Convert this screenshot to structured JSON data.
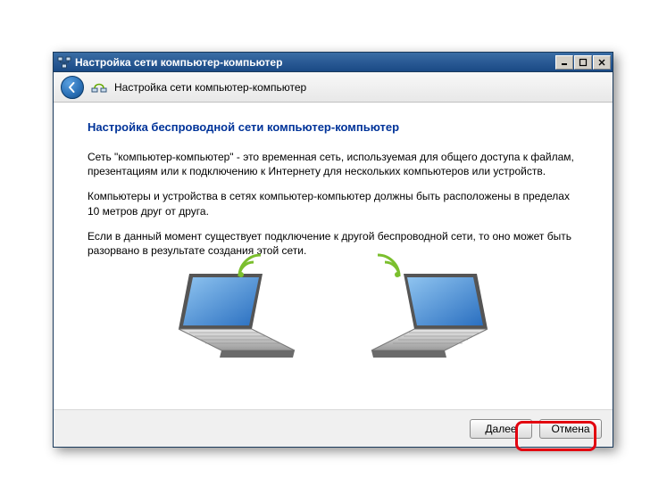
{
  "window": {
    "title": "Настройка сети компьютер-компьютер"
  },
  "header": {
    "title": "Настройка сети компьютер-компьютер"
  },
  "page": {
    "heading": "Настройка беспроводной сети компьютер-компьютер",
    "p1": "Сеть \"компьютер-компьютер\" - это временная сеть, используемая для общего доступа к файлам, презентациям или к подключению к Интернету для нескольких компьютеров или устройств.",
    "p2": "Компьютеры и устройства в сетях компьютер-компьютер должны быть расположены в пределах 10 метров друг от друга.",
    "p3": "Если в данный момент существует подключение к другой беспроводной сети, то оно может быть разорвано в результате создания этой сети."
  },
  "footer": {
    "next": "Далее",
    "cancel": "Отмена"
  }
}
